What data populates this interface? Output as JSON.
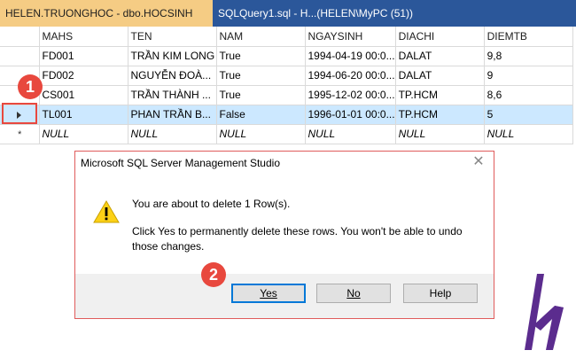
{
  "tabs": [
    {
      "label": "HELEN.TRUONGHOC - dbo.HOCSINH",
      "active": true
    },
    {
      "label": "SQLQuery1.sql - H...(HELEN\\MyPC (51))",
      "active": false
    }
  ],
  "grid": {
    "columns": [
      "MAHS",
      "TEN",
      "NAM",
      "NGAYSINH",
      "DIACHI",
      "DIEMTB"
    ],
    "rows": [
      [
        "FD001",
        "TRẦN KIM LONG",
        "True",
        "1994-04-19 00:0...",
        "DALAT",
        "9,8"
      ],
      [
        "FD002",
        "NGUYỄN ĐOÀ...",
        "True",
        "1994-06-20 00:0...",
        "DALAT",
        "9"
      ],
      [
        "CS001",
        "TRẦN THÀNH ...",
        "True",
        "1995-12-02 00:0...",
        "TP.HCM",
        "8,6"
      ],
      [
        "TL001",
        "PHAN TRẦN B...",
        "False",
        "1996-01-01 00:0...",
        "TP.HCM",
        "5"
      ]
    ],
    "null_row": [
      "NULL",
      "NULL",
      "NULL",
      "NULL",
      "NULL",
      "NULL"
    ],
    "selected_row_index": 3,
    "row_marker_icon": "current-row-arrow",
    "new_row_marker": "*"
  },
  "callouts": {
    "step1": "1",
    "step2": "2"
  },
  "dialog": {
    "title": "Microsoft SQL Server Management Studio",
    "close_icon": "close-icon",
    "icon": "warning-icon",
    "message_line1": "You are about to delete 1 Row(s).",
    "message_line2": "Click Yes to permanently delete these rows. You won't be able to undo those changes.",
    "buttons": {
      "yes": "Yes",
      "no": "No",
      "help": "Help"
    }
  },
  "colors": {
    "tab_bar": "#2b579a",
    "active_tab": "#f5cc84",
    "selected_row": "#cce8ff",
    "callout": "#e8483e",
    "logo": "#5b2c8e"
  },
  "logo": "h-logo"
}
